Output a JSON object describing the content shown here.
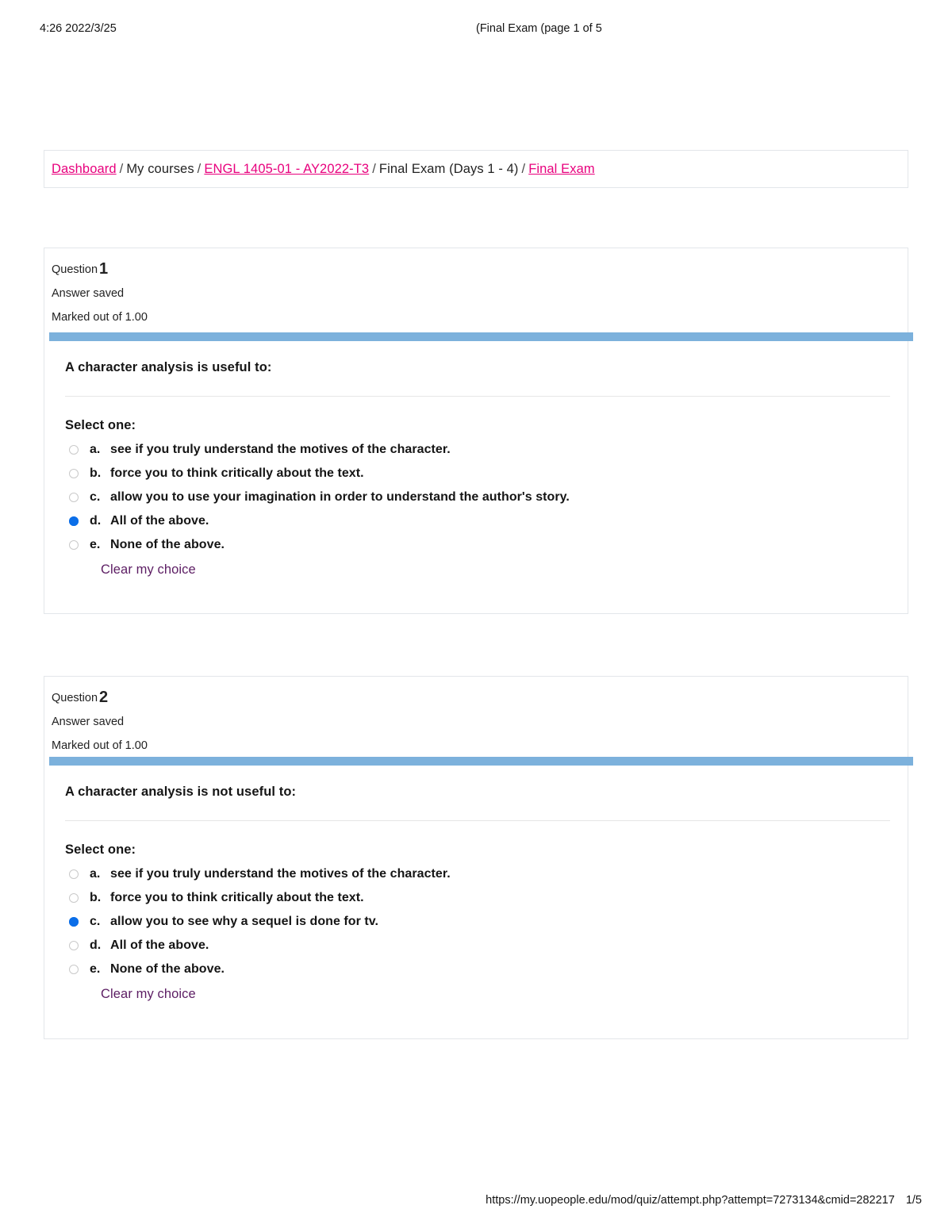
{
  "print_header": {
    "left": "‎4:26 2022/3/25",
    "right": "(Final Exam (page 1 of 5"
  },
  "breadcrumb": {
    "separator": "/",
    "items": [
      {
        "label": "Dashboard",
        "link": true
      },
      {
        "label": "My courses",
        "link": false
      },
      {
        "label": "ENGL 1405-01 - AY2022-T3",
        "link": true
      },
      {
        "label": "Final Exam (Days 1 - 4)",
        "link": false
      },
      {
        "label": "Final Exam",
        "link": true
      }
    ]
  },
  "colors": {
    "link_pink": "#e8007d",
    "blue_bar": "#7cb1dc",
    "radio_selected": "#0b6ee8",
    "clear_choice_purple": "#5c1d63"
  },
  "questions": [
    {
      "number_label": "Question",
      "number": "1",
      "status": "Answer saved",
      "marks": "Marked out of 1.00",
      "text": "A character analysis is useful to:",
      "select_one_label": "Select one:",
      "clear_choice_label": "Clear my choice",
      "options": [
        {
          "letter": "a.",
          "text": "see if you truly understand the motives of the character.",
          "selected": false
        },
        {
          "letter": "b.",
          "text": "force you to think critically about the text.",
          "selected": false
        },
        {
          "letter": "c.",
          "text": "allow you to use your imagination in order to understand the author's story.",
          "selected": false
        },
        {
          "letter": "d.",
          "text": "All of the above.",
          "selected": true
        },
        {
          "letter": "e.",
          "text": "None of the above.",
          "selected": false
        }
      ]
    },
    {
      "number_label": "Question",
      "number": "2",
      "status": "Answer saved",
      "marks": "Marked out of 1.00",
      "text": "A character analysis is not useful to:",
      "select_one_label": "Select one:",
      "clear_choice_label": "Clear my choice",
      "options": [
        {
          "letter": "a.",
          "text": "see if you truly understand the motives of the character.",
          "selected": false
        },
        {
          "letter": "b.",
          "text": "force you to think critically about the text.",
          "selected": false
        },
        {
          "letter": "c.",
          "text": "allow you to see why a sequel is done for tv.",
          "selected": true
        },
        {
          "letter": "d.",
          "text": "All of the above.",
          "selected": false
        },
        {
          "letter": "e.",
          "text": "None of the above.",
          "selected": false
        }
      ]
    }
  ],
  "print_footer": {
    "url": "https://my.uopeople.edu/mod/quiz/attempt.php?attempt=7273134&cmid=282217",
    "page": "1/5"
  }
}
